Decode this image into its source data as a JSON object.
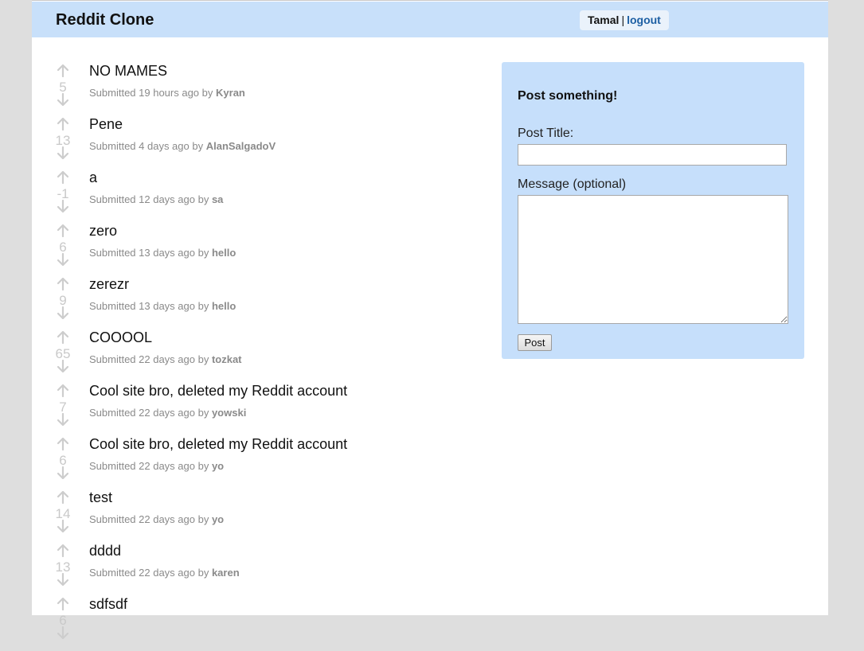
{
  "header": {
    "title": "Reddit Clone",
    "username": "Tamal",
    "separator": "|",
    "logout_label": "logout"
  },
  "posts": [
    {
      "score": "5",
      "title": "NO MAMES",
      "meta": "Submitted 19 hours ago by",
      "author": "Kyran"
    },
    {
      "score": "13",
      "title": "Pene",
      "meta": "Submitted 4 days ago by",
      "author": "AlanSalgadoV"
    },
    {
      "score": "-1",
      "title": "a",
      "meta": "Submitted 12 days ago by",
      "author": "sa"
    },
    {
      "score": "6",
      "title": "zero",
      "meta": "Submitted 13 days ago by",
      "author": "hello"
    },
    {
      "score": "9",
      "title": "zerezr",
      "meta": "Submitted 13 days ago by",
      "author": "hello"
    },
    {
      "score": "65",
      "title": "COOOOL",
      "meta": "Submitted 22 days ago by",
      "author": "tozkat"
    },
    {
      "score": "7",
      "title": "Cool site bro, deleted my Reddit account",
      "meta": "Submitted 22 days ago by",
      "author": "yowski"
    },
    {
      "score": "6",
      "title": "Cool site bro, deleted my Reddit account",
      "meta": "Submitted 22 days ago by",
      "author": "yo"
    },
    {
      "score": "14",
      "title": "test",
      "meta": "Submitted 22 days ago by",
      "author": "yo"
    },
    {
      "score": "13",
      "title": "dddd",
      "meta": "Submitted 22 days ago by",
      "author": "karen"
    },
    {
      "score": "6",
      "title": "sdfsdf",
      "meta": "",
      "author": ""
    }
  ],
  "sidebar": {
    "heading": "Post something!",
    "title_label": "Post Title:",
    "title_value": "",
    "message_label": "Message (optional)",
    "message_value": "",
    "post_button": "Post"
  },
  "icons": {
    "upvote": "up-arrow-icon",
    "downvote": "down-arrow-icon"
  }
}
